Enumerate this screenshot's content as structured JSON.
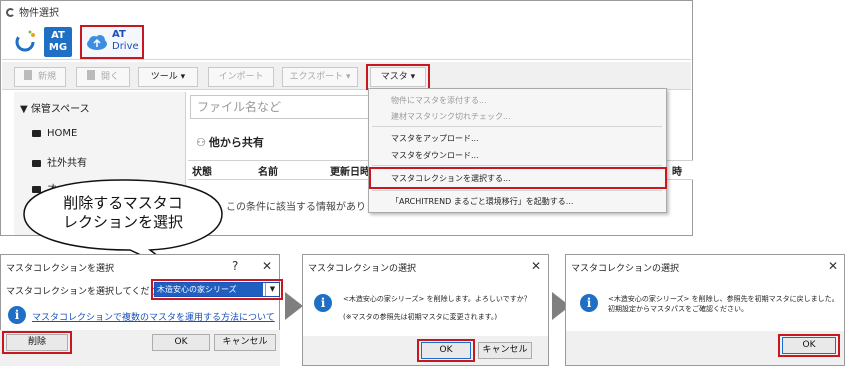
{
  "main_window": {
    "title": "物件選択",
    "app_tiles": {
      "atmg_line1": "AT",
      "atmg_line2": "MG",
      "drive_line1": "AT",
      "drive_line2": "Drive"
    },
    "toolbar": {
      "new_label": "新規",
      "open_label": "開く",
      "tool_label": "ツール",
      "import_label": "インポート",
      "export_label": "エクスポート",
      "master_label": "マスタ"
    },
    "sidebar": {
      "header": "保管スペース",
      "items": [
        "HOME",
        "社外共有",
        "オープ"
      ]
    },
    "search_placeholder": "ファイル名など",
    "shared_label": "他から共有",
    "columns": [
      "状態",
      "名前",
      "更新日時",
      "時"
    ],
    "empty_message": "この条件に該当する情報がありま"
  },
  "master_menu": {
    "items": [
      "物件にマスタを添付する...",
      "建材マスタリンク切れチェック...",
      "マスタをアップロード...",
      "マスタをダウンロード...",
      "マスタコレクションを選択する...",
      "「ARCHITREND まるごと環境移行」を起動する..."
    ]
  },
  "callout": {
    "text_line1": "削除するマスタコ",
    "text_line2": "レクションを選択"
  },
  "dialog1": {
    "title": "マスタコレクションを選択",
    "help_label": "?",
    "prompt": "マスタコレクションを選択してください。",
    "selected_value": "木造安心の家シリーズ",
    "link_text": "マスタコレクションで複数のマスタを運用する方法について",
    "delete_button": "削除",
    "ok_button": "OK",
    "cancel_button": "キャンセル"
  },
  "dialog2": {
    "title": "マスタコレクションの選択",
    "message": "<木造安心の家シリーズ> を削除します。よろしいですか？",
    "note": "(※マスタの参照先は初期マスタに変更されます。)",
    "ok_button": "OK",
    "cancel_button": "キャンセル"
  },
  "dialog3": {
    "title": "マスタコレクションの選択",
    "message_line1": "<木造安心の家シリーズ> を削除し、参照先を初期マスタに戻しました。",
    "message_line2": "初期設定からマスタパスをご確認ください。",
    "ok_button": "OK"
  },
  "close_glyph": "✕",
  "colors": {
    "highlight_red": "#c8171e",
    "info_blue": "#1f6fc5",
    "link_blue": "#1a4fb8",
    "arrow_gray": "#7f7f7f"
  }
}
